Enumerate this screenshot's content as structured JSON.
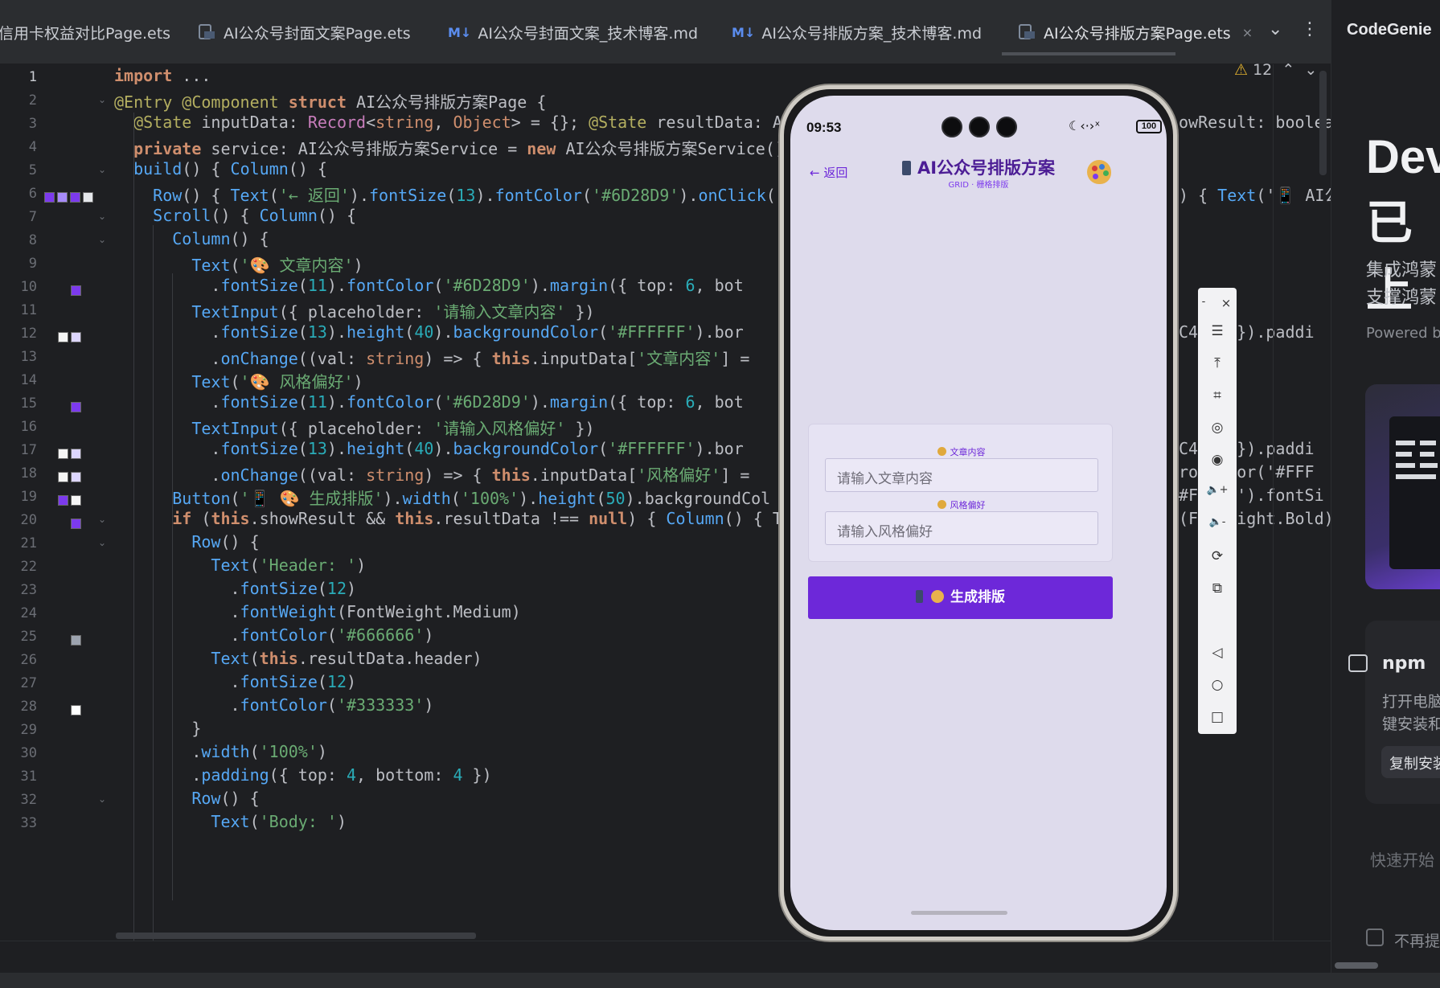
{
  "tabs": [
    {
      "label": "信用卡权益对比Page.ets",
      "kind": "ets",
      "active": false
    },
    {
      "label": "AI公众号封面文案Page.ets",
      "kind": "ets",
      "active": false
    },
    {
      "label": "AI公众号封面文案_技术博客.md",
      "kind": "md",
      "active": false
    },
    {
      "label": "AI公众号排版方案_技术博客.md",
      "kind": "md",
      "active": false
    },
    {
      "label": "AI公众号排版方案Page.ets",
      "kind": "ets",
      "active": true
    }
  ],
  "tab_md_marker": "M↓",
  "tab_close": "×",
  "tab_more": "⌄",
  "tab_kebab": "⋮",
  "inspection": {
    "count": "12",
    "icon": "⚠"
  },
  "right_panel": {
    "title": "CodeGenie",
    "heading_line1": "Dev",
    "heading_line2": "已上",
    "sub_line1": "集成鸿蒙",
    "sub_line2": "支撑鸿蒙",
    "powered_by": "Powered by",
    "npm_title": "npm",
    "npm_line1": "打开电脑",
    "npm_line2": "键安装和",
    "copy_button": "复制安装",
    "quick_start": "快速开始",
    "no_remind": "不再提醒"
  },
  "line_numbers": [
    "1",
    "2",
    "3",
    "4",
    "5",
    "6",
    "7",
    "8",
    "9",
    "10",
    "11",
    "12",
    "13",
    "14",
    "15",
    "16",
    "17",
    "18",
    "19",
    "20",
    "21",
    "22",
    "23",
    "24",
    "25",
    "26",
    "27",
    "28",
    "29",
    "30",
    "31",
    "32",
    "33"
  ],
  "code_lines_left": [
    "import ...",
    "@Entry @Component struct AI公众号排版方案Page {",
    "  @State inputData: Record<string, Object> = {}; @State resultData: AI",
    "  private service: AI公众号排版方案Service = new AI公众号排版方案Service()",
    "  build() { Column() {",
    "    Row() { Text('← 返回').fontSize(13).fontColor('#6D28D9').onClick((",
    "    Scroll() { Column() {",
    "      Column() {",
    "        Text('🎨 文章内容')",
    "          .fontSize(11).fontColor('#6D28D9').margin({ top: 6, bot",
    "        TextInput({ placeholder: '请输入文章内容' })",
    "          .fontSize(13).height(40).backgroundColor('#FFFFFF').bor",
    "          .onChange((val: string) => { this.inputData['文章内容'] =",
    "        Text('🎨 风格偏好')",
    "          .fontSize(11).fontColor('#6D28D9').margin({ top: 6, bot",
    "        TextInput({ placeholder: '请输入风格偏好' })",
    "          .fontSize(13).height(40).backgroundColor('#FFFFFF').bor",
    "          .onChange((val: string) => { this.inputData['风格偏好'] =",
    "      Button('📱 🎨 生成排版').width('100%').height(50).backgroundCol",
    "      if (this.showResult && this.resultData !== null) { Column() { T",
    "        Row() {",
    "          Text('Header: ')",
    "            .fontSize(12)",
    "            .fontWeight(FontWeight.Medium)",
    "            .fontColor('#666666')",
    "          Text(this.resultData.header)",
    "            .fontSize(12)",
    "            .fontColor('#333333')",
    "        }",
    "        .width('100%')",
    "        .padding({ top: 4, bottom: 4 })",
    "        Row() {",
    "          Text('Body: ')"
  ],
  "code_lines_right": [
    {
      "line": 3,
      "text": "owResult: boolea"
    },
    {
      "line": 6,
      "text": ") { Text('📱 AI公"
    },
    {
      "line": 12,
      "text": "C4  ' }).paddi"
    },
    {
      "line": 17,
      "text": "C4  ' }).paddi"
    },
    {
      "line": 18,
      "text": "ro  olor('#FFF"
    },
    {
      "line": 19,
      "text": "#FF  F').fontSi"
    },
    {
      "line": 20,
      "text": "(Fo  eight.Bold)"
    }
  ],
  "colors": {
    "accent": "#6D28D9",
    "editor_bg": "#1e1f22",
    "phone_bg": "#dedbec",
    "button_bg": "#6D28D9"
  },
  "phone": {
    "time": "09:53",
    "status_icons": "☾‹·›ˣ",
    "battery": "100",
    "back": "← 返回",
    "title": "AI公众号排版方案",
    "subtitle": "GRID · 栅格排版",
    "field1_label": "文章内容",
    "field1_placeholder": "请输入文章内容",
    "field2_label": "风格偏好",
    "field2_placeholder": "请输入风格偏好",
    "button_label": "生成排版"
  },
  "emulator_tools": [
    "-",
    "×",
    "☰",
    "⤒",
    "⌗",
    "◎",
    "◉",
    "🔈+",
    "🔈-",
    "⟳",
    "⧉",
    "◁",
    "○",
    "□"
  ]
}
